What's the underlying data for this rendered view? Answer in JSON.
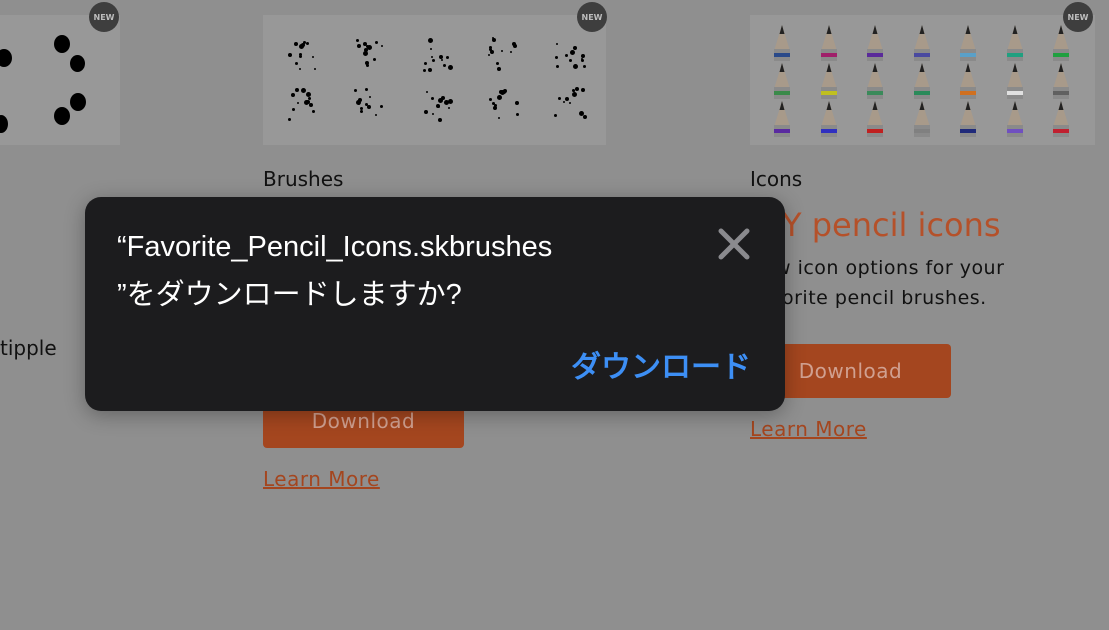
{
  "cards": [
    {
      "badge": "NEW",
      "label": "",
      "partial_text": "tipple"
    },
    {
      "badge": "NEW",
      "label": "Brushes",
      "button": "Download",
      "link": "Learn More"
    },
    {
      "badge": "NEW",
      "label": "Icons",
      "heading": "Y pencil icons",
      "description_line1": "w icon options for your",
      "description_line2": "orite pencil brushes.",
      "button": "Download",
      "link": "Learn More"
    }
  ],
  "pencil_band_colors": [
    "#2a4a8a",
    "#a0206a",
    "#5a2a9a",
    "#4a4aa0",
    "#5aa0c8",
    "#20a080",
    "#20a040",
    "#3a8a4a",
    "#c0c020",
    "#3a8a5a",
    "#2a8a5a",
    "#d07020",
    "#e0e0e0",
    "#606060",
    "#5a2aa0",
    "#3030c0",
    "#c02020",
    "#808080",
    "#202a7a",
    "#7050c0",
    "#c02030"
  ],
  "dialog": {
    "title_line1": "“Favorite_Pencil_Icons.skbrushes",
    "title_line2": "”をダウンロードしますか?",
    "close_icon": "close-icon",
    "action": "ダウンロード",
    "action_color": "#3d8ff5"
  }
}
